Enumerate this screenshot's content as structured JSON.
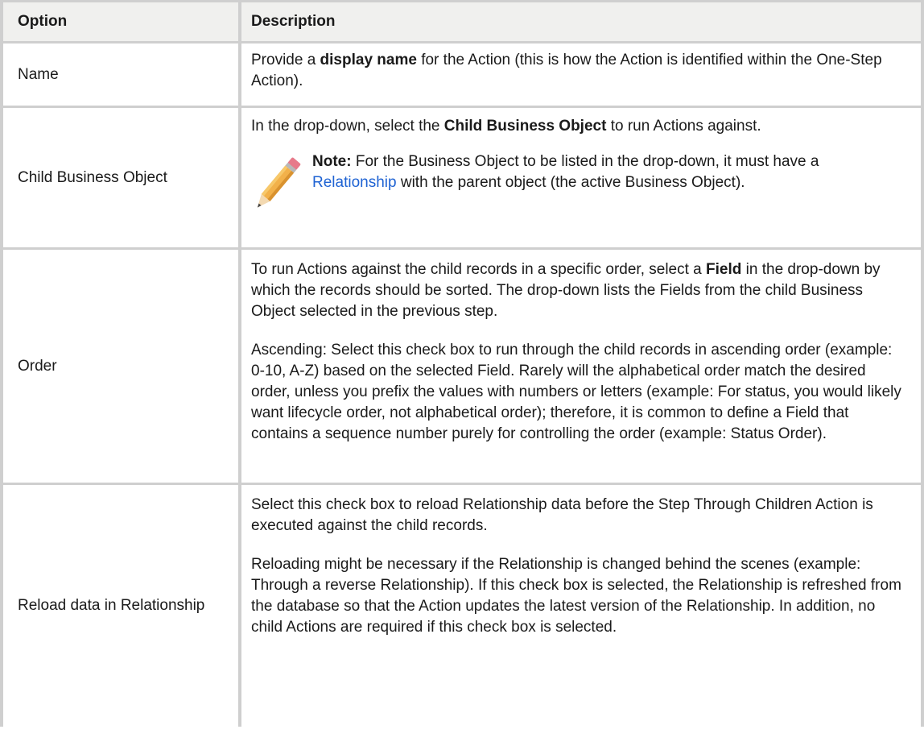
{
  "headers": {
    "option": "Option",
    "description": "Description"
  },
  "rows": {
    "name": {
      "option": "Name",
      "desc_pre": "Provide a ",
      "desc_bold": "display name",
      "desc_post": " for the Action (this is how the Action is identified within the One-Step Action)."
    },
    "child": {
      "option": "Child Business Object",
      "desc_pre": "In the drop-down, select the ",
      "desc_bold": "Child Business Object",
      "desc_post": " to run Actions against.",
      "note_label": "Note:",
      "note_pre": " For the Business Object to be listed in the drop-down, it must have a ",
      "note_link": "Relationship",
      "note_post": " with the parent object (the active Business Object).",
      "note_icon": "pencil-icon"
    },
    "order": {
      "option": "Order",
      "p1_pre": "To run Actions against the child records in a specific order, select a ",
      "p1_bold": "Field",
      "p1_post": " in the drop-down by which the records should be sorted. The drop-down lists the Fields from the child Business Object selected in the previous step.",
      "p2": "Ascending: Select this check box to run through the child records in ascending order (example: 0-10, A-Z) based on the selected Field. Rarely will the alphabetical order match the desired order, unless you prefix the values with numbers or letters (example: For status, you would likely want lifecycle order, not alphabetical order); therefore, it is common to define a Field that contains a sequence number purely for controlling the order (example: Status Order)."
    },
    "reload": {
      "option": "Reload data in Relationship",
      "p1": "Select this check box to reload Relationship data before the Step Through Children Action is executed against the child records.",
      "p2": "Reloading might be necessary if the Relationship is changed behind the scenes (example: Through a reverse Relationship). If this check box is selected, the Relationship is refreshed from the database so that the Action updates the latest version of the Relationship. In addition, no child Actions are required if this check box is selected."
    }
  },
  "colors": {
    "header_bg": "#f0f0ee",
    "border": "#cfcfcf",
    "link": "#1f63d3"
  }
}
